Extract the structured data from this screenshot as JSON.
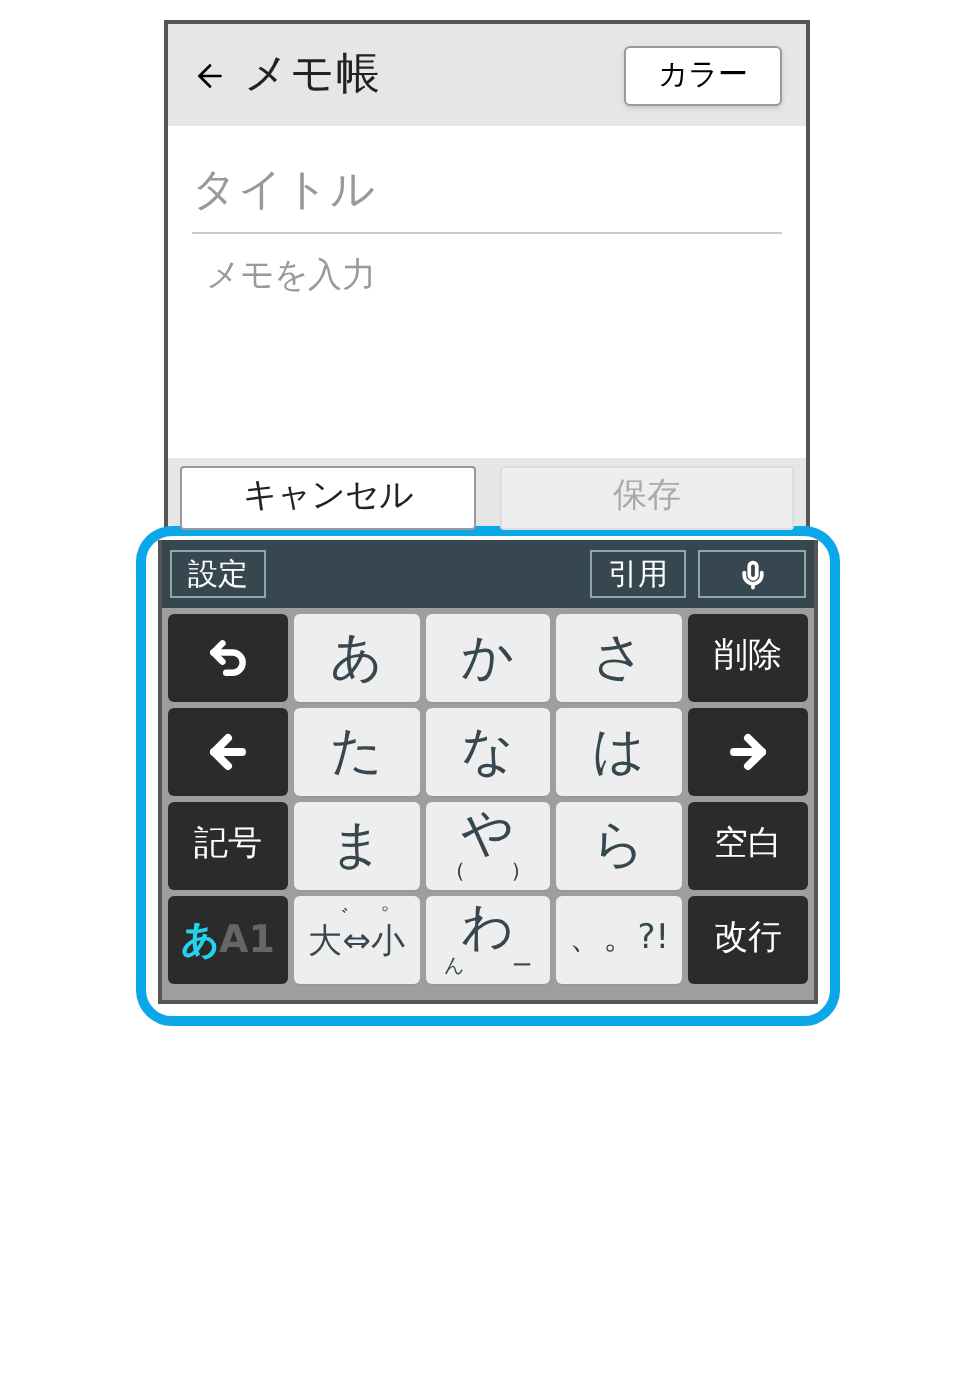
{
  "header": {
    "title": "メモ帳",
    "color_button": "カラー"
  },
  "title_field": {
    "placeholder": "タイトル"
  },
  "memo_field": {
    "placeholder": "メモを入力"
  },
  "actions": [
    {
      "label": "キャンセル",
      "disabled": false
    },
    {
      "label": "保存",
      "disabled": true
    }
  ],
  "keyboard_toolbar": {
    "settings": "設定",
    "quote": "引用"
  },
  "keys": [
    {
      "kind": "back"
    },
    {
      "kind": "kana",
      "label": "あ"
    },
    {
      "kind": "kana",
      "label": "か"
    },
    {
      "kind": "kana",
      "label": "さ"
    },
    {
      "kind": "function",
      "label": "削除"
    },
    {
      "kind": "left"
    },
    {
      "kind": "kana",
      "label": "た"
    },
    {
      "kind": "kana",
      "label": "な"
    },
    {
      "kind": "kana",
      "label": "は"
    },
    {
      "kind": "right"
    },
    {
      "kind": "function",
      "label": "記号"
    },
    {
      "kind": "kana",
      "label": "ま"
    },
    {
      "kind": "kana",
      "label": "や",
      "subs": [
        "(",
        ")"
      ]
    },
    {
      "kind": "kana",
      "label": "ら"
    },
    {
      "kind": "function",
      "label": "空白"
    },
    {
      "kind": "mode",
      "parts": [
        {
          "text": "あ",
          "selected": true
        },
        {
          "text": "A1",
          "selected": false
        }
      ]
    },
    {
      "kind": "kana",
      "label": "大⇔小",
      "tops": [
        "゛",
        "゜"
      ]
    },
    {
      "kind": "kana",
      "label": "わ",
      "subs": [
        "ん",
        "ー"
      ]
    },
    {
      "kind": "kana",
      "label": "、。?!"
    },
    {
      "kind": "function",
      "label": "改行"
    }
  ]
}
